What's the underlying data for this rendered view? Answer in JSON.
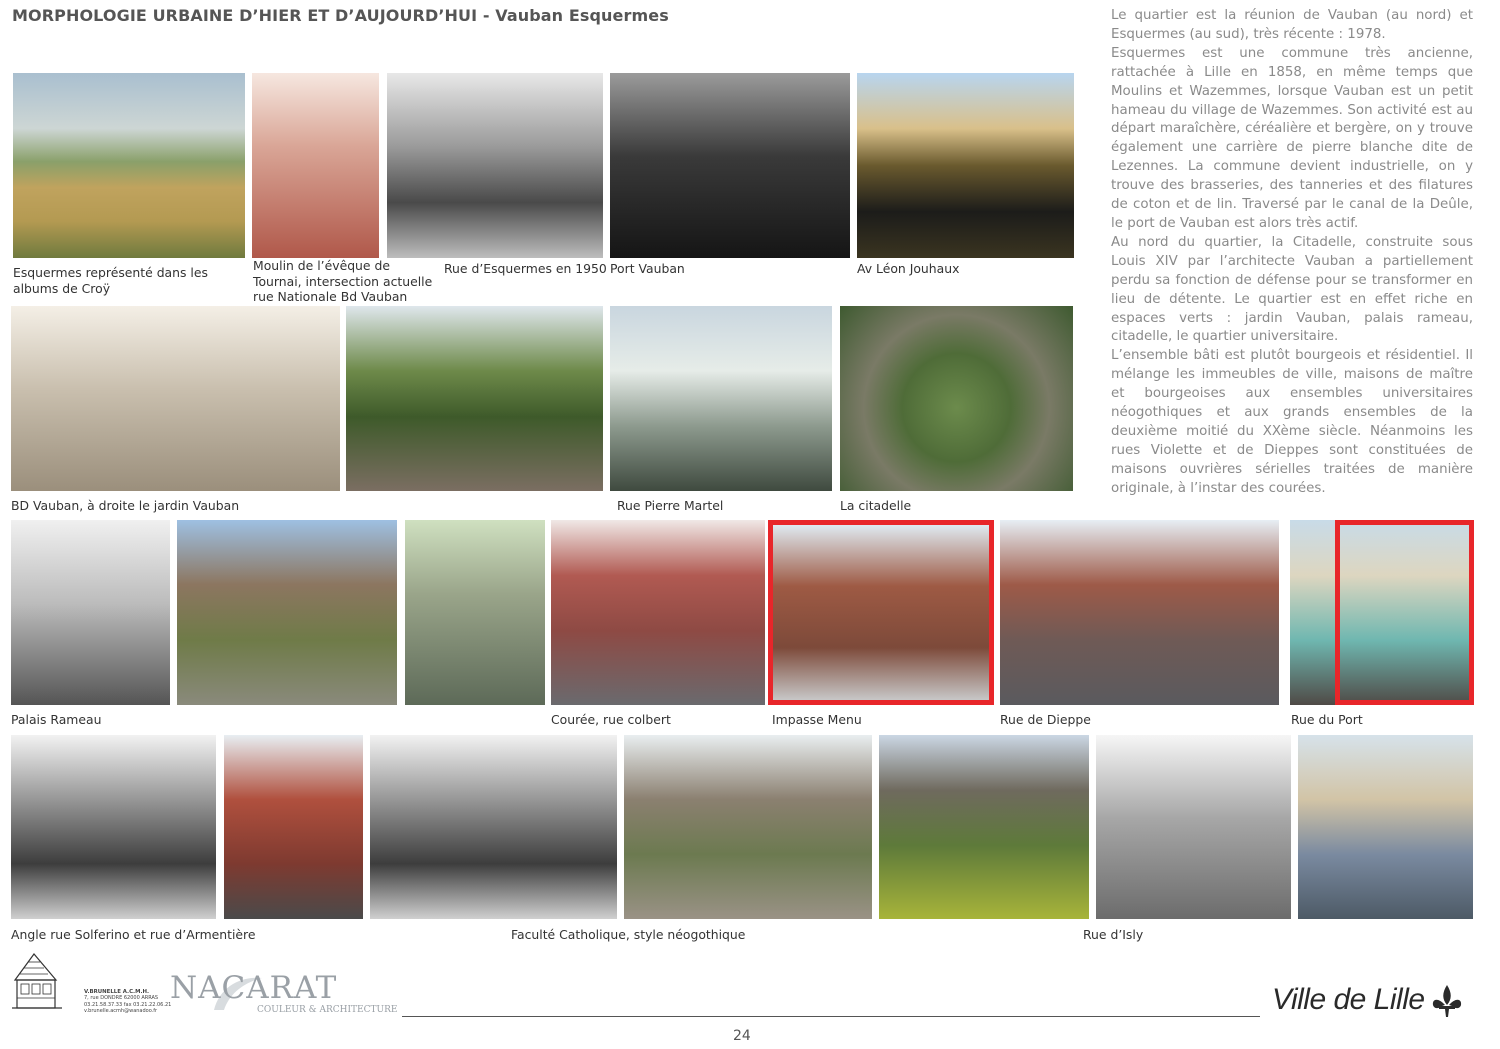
{
  "header": {
    "title": "MORPHOLOGIE URBAINE D’HIER ET D’AUJOURD’HUI - Vauban Esquermes"
  },
  "intro": {
    "paragraphs": [
      "Le quartier est la réunion de Vauban (au nord) et Esquermes (au sud), très récente : 1978.",
      "Esquermes est une commune très ancienne, rattachée à Lille en 1858, en même temps que Moulins et Wazemmes, lorsque Vauban est un petit hameau du village de Wazemmes. Son activité est au départ maraîchère, céréalière et bergère, on y trouve également une carrière de pierre blanche dite de Lezennes. La commune devient industrielle, on y trouve des brasseries, des tanneries et des filatures de coton et de lin. Traversé par le canal de la Deûle, le port de Vauban est alors très actif.",
      "Au nord du quartier, la Citadelle, construite sous Louis XIV par l’architecte Vauban a partiellement perdu sa fonction de défense pour se transformer en lieu de détente. Le quartier est en effet riche en espaces verts : jardin Vauban, palais rameau, citadelle, le quartier universitaire.",
      "L’ensemble bâti est plutôt bourgeois et résidentiel. Il mélange les immeubles de ville, maisons de maître et bourgeoises aux ensembles universitaires néogothiques et aux grands ensembles de la deuxième moitié du XXème siècle. Néanmoins les rues Violette et de Dieppes sont constituées de maisons ouvrières sérielles traitées de manière originale, à l’instar des courées."
    ]
  },
  "captions": {
    "esquermes_croy": "Esquermes représenté dans les albums de Croÿ",
    "moulin": "Moulin de l’évêque de Tournai, intersection actuelle rue Nationale Bd Vauban",
    "rue_esquermes_1950": "Rue d’Esquermes en 1950",
    "port_vauban": "Port Vauban",
    "av_leon_jouhaux": "Av Léon Jouhaux",
    "bd_vauban": "BD Vauban, à droite le jardin Vauban",
    "rue_pierre_martel": "Rue Pierre Martel",
    "citadelle": "La citadelle",
    "palais_rameau": "Palais Rameau",
    "couree_colbert": "Courée, rue colbert",
    "impasse_menu": "Impasse Menu",
    "rue_dieppe": "Rue de Dieppe",
    "rue_du_port": "Rue du Port",
    "angle_solferino": "Angle rue Solferino et rue d’Armentière",
    "faculte_catholique": "Faculté Catholique, style néogothique",
    "rue_isly": "Rue d’Isly"
  },
  "footer": {
    "architect_name": "V.BRUNELLE A.C.M.H.",
    "architect_address": "7, rue DONDRE 62000 ARRAS",
    "architect_phone": "03.21.58.37.33  fax 03.21.22.06.21",
    "architect_email": "v.brunelle.acmh@wanadoo.fr",
    "nacarat_logo": "NACARAT",
    "nacarat_subtitle": "COULEUR & ARCHITECTURE",
    "page_number": "24",
    "ville_de_lille": "Ville de Lille"
  },
  "colors": {
    "highlight_frame": "#e8262a",
    "title_gray": "#555555",
    "intro_gray": "#8a8a8a"
  }
}
